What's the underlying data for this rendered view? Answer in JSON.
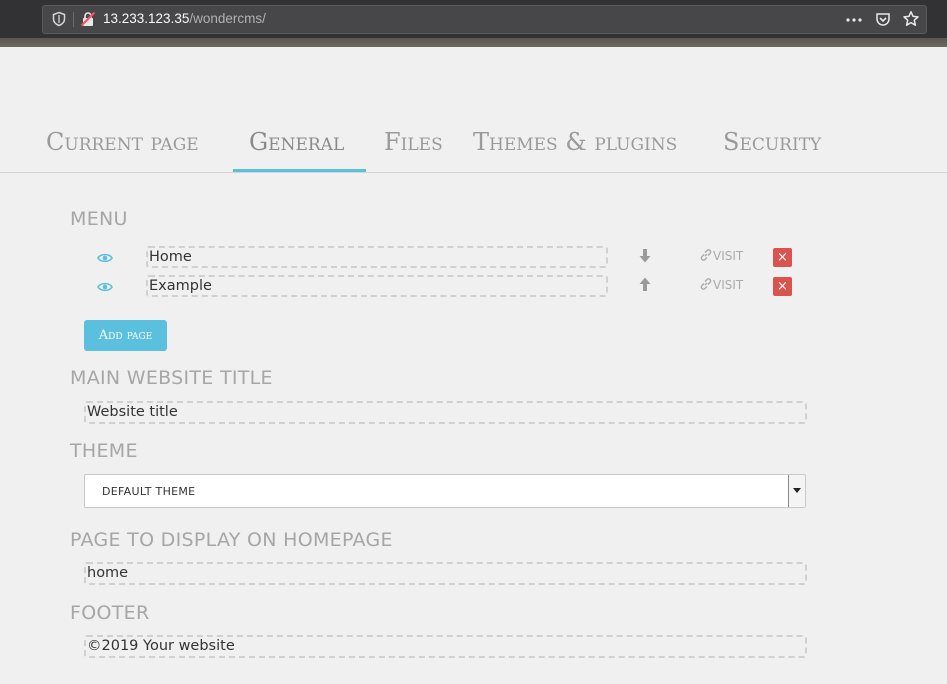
{
  "browser": {
    "url_host": "13.233.123.35",
    "url_path": "/wondercms/",
    "icons": [
      "shield-icon",
      "lock-icon",
      "more-icon",
      "pocket-icon",
      "star-icon"
    ]
  },
  "tabs": [
    {
      "label": "Current page",
      "active": false
    },
    {
      "label": "General",
      "active": true
    },
    {
      "label": "Files",
      "active": false
    },
    {
      "label": "Themes & plugins",
      "active": false
    },
    {
      "label": "Security",
      "active": false
    }
  ],
  "menu": {
    "label": "Menu",
    "items": [
      {
        "value": "Home",
        "visit_label": "VISIT",
        "delete_label": "×"
      },
      {
        "value": "Example",
        "visit_label": "VISIT",
        "delete_label": "×"
      }
    ],
    "add_label": "Add page"
  },
  "title_section": {
    "label": "Main website title",
    "value": "Website title"
  },
  "theme_section": {
    "label": "Theme",
    "selected": "default theme"
  },
  "homepage_section": {
    "label": "Page to display on homepage",
    "value": "home"
  },
  "footer_section": {
    "label": "Footer",
    "value": "©2019 Your website"
  },
  "colors": {
    "accent": "#5bc0de",
    "danger": "#d9534f"
  }
}
